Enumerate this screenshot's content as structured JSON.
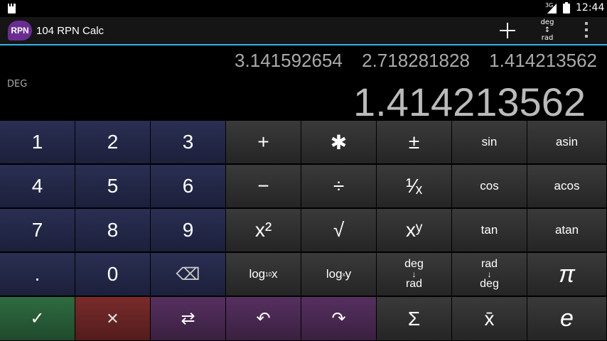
{
  "status_bar": {
    "network": "3G",
    "time": "12:44"
  },
  "app": {
    "logo_text": "RPN",
    "title": "104 RPN Calc"
  },
  "actions": {
    "angle_top": "deg",
    "angle_arrow": "↕",
    "angle_bottom": "rad"
  },
  "display": {
    "mode": "DEG",
    "stack": [
      "3.141592654",
      "2.718281828",
      "1.414213562"
    ],
    "x_value": "1.414213562"
  },
  "keys": {
    "k1": "1",
    "k2": "2",
    "k3": "3",
    "plus": "+",
    "multiply": "✱",
    "plusminus": "±",
    "sin": "sin",
    "asin": "asin",
    "k4": "4",
    "k5": "5",
    "k6": "6",
    "minus": "−",
    "divide": "÷",
    "reciprocal": "¹⁄ₓ",
    "cos": "cos",
    "acos": "acos",
    "k7": "7",
    "k8": "8",
    "k9": "9",
    "square": "x²",
    "sqrt": "√",
    "power": "xʸ",
    "tan": "tan",
    "atan": "atan",
    "dot": ".",
    "k0": "0",
    "backspace": "⌫",
    "log10_base": "log",
    "log10_sub": "10",
    "log10_arg": "x",
    "logxy_base": "log",
    "logxy_sub": "x",
    "logxy_arg": "y",
    "deg_to_rad_top": "deg",
    "deg_to_rad_arrow": "↓",
    "deg_to_rad_bottom": "rad",
    "rad_to_deg_top": "rad",
    "rad_to_deg_arrow": "↓",
    "rad_to_deg_bottom": "deg",
    "pi": "π",
    "enter": "✓",
    "clear": "✕",
    "swap": "⇄",
    "undo": "↶",
    "redo": "↷",
    "sum": "Σ",
    "mean": "x̄",
    "e": "e"
  }
}
